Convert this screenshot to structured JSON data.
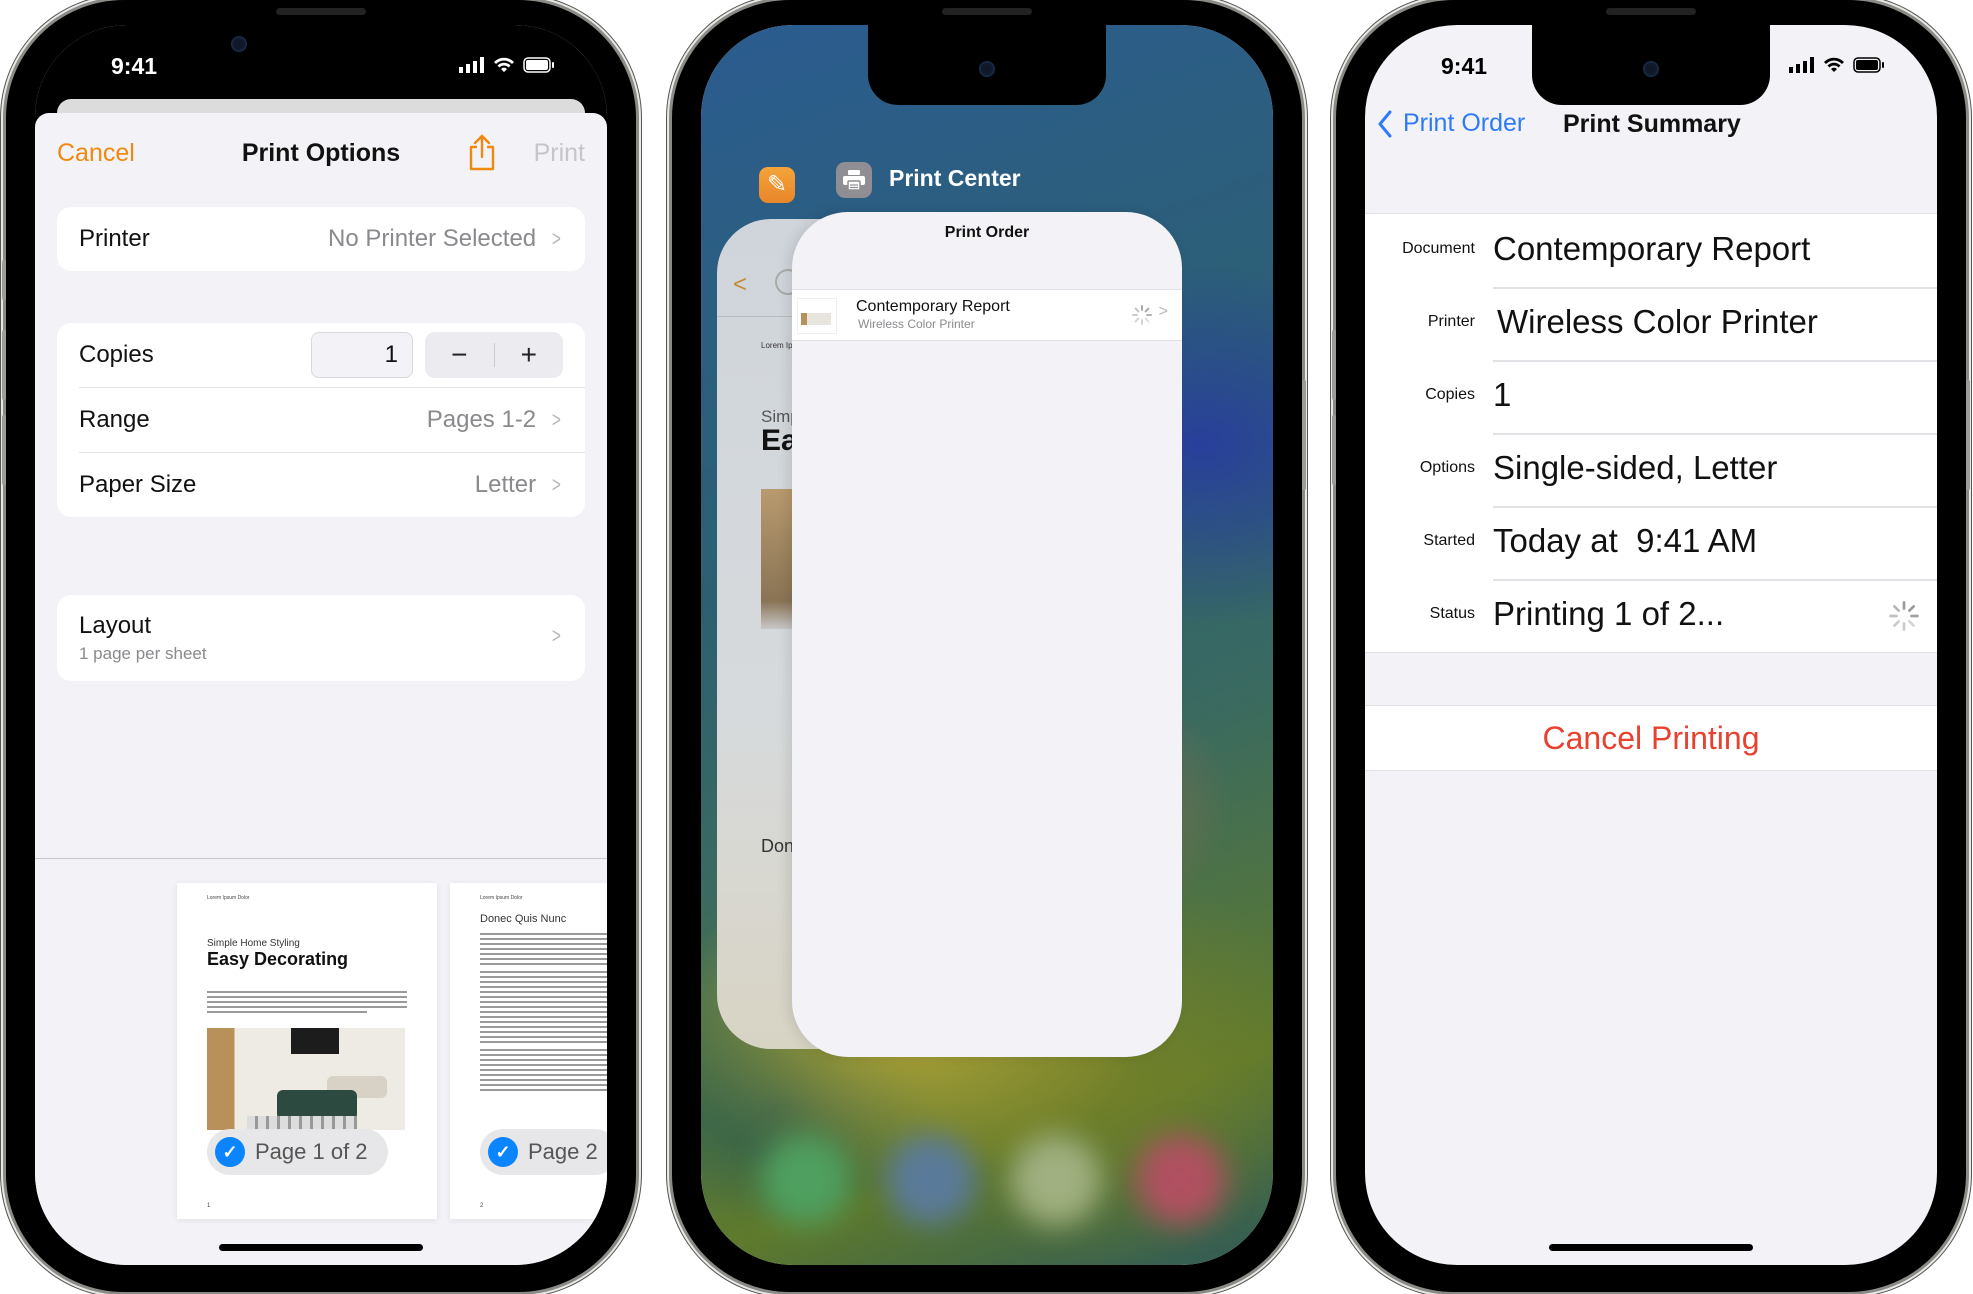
{
  "status_bar": {
    "time": "9:41",
    "icons": [
      "cellular-signal-icon",
      "wifi-icon",
      "battery-icon"
    ]
  },
  "colors": {
    "orange_accent": "#f0890f",
    "blue_accent": "#2f7bf6",
    "destructive_red": "#e8412f",
    "checkbox_blue": "#0a84ff",
    "grouped_bg": "#f2f2f7"
  },
  "print_options": {
    "nav": {
      "cancel_label": "Cancel",
      "title": "Print Options",
      "share_icon": "share-icon",
      "print_label": "Print"
    },
    "printer": {
      "label": "Printer",
      "value": "No Printer Selected"
    },
    "copies": {
      "label": "Copies",
      "value": "1",
      "decrement": "−",
      "increment": "+"
    },
    "range": {
      "label": "Range",
      "value": "Pages 1-2"
    },
    "paper_size": {
      "label": "Paper Size",
      "value": "Letter"
    },
    "layout": {
      "label": "Layout",
      "sublabel": "1 page per sheet"
    },
    "pages": [
      {
        "header": "Lorem Ipsum Dolor",
        "subtitle": "Simple Home Styling",
        "title": "Easy Decorating",
        "number": "1",
        "badge": "Page 1 of 2",
        "selected": true
      },
      {
        "header": "Lorem Ipsum Dolor",
        "title": "Donec Quis Nunc",
        "number": "2",
        "badge": "Page 2",
        "selected": true
      }
    ]
  },
  "app_switcher": {
    "apps": [
      {
        "name": "Pages",
        "icon": "pages-app-icon"
      },
      {
        "name": "Print Center",
        "icon": "printer-icon"
      }
    ],
    "background_card": {
      "header": "Lorem Ipsum",
      "subtitle": "Simp",
      "title": "Ea",
      "section": "Done"
    },
    "print_center_card": {
      "title": "Print Order",
      "job": {
        "name": "Contemporary Report",
        "printer": "Wireless Color Printer",
        "status_icon": "spinner-icon"
      }
    }
  },
  "print_summary": {
    "nav": {
      "back_label": "Print Order",
      "title": "Print Summary"
    },
    "rows": [
      {
        "label": "Document",
        "value": "Contemporary Report"
      },
      {
        "label": "Printer",
        "value": "Wireless Color Printer"
      },
      {
        "label": "Copies",
        "value": "1"
      },
      {
        "label": "Options",
        "value": "Single-sided, Letter"
      },
      {
        "label": "Started",
        "value": "Today at  9:41 AM"
      },
      {
        "label": "Status",
        "value": "Printing 1 of 2..."
      }
    ],
    "cancel_label": "Cancel Printing"
  }
}
